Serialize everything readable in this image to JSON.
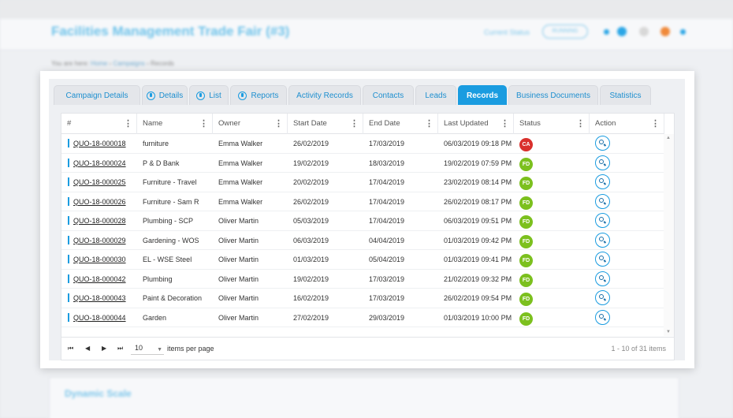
{
  "app": {
    "title": "Facilities Management Trade Fair (#3)",
    "status_label": "Current Status",
    "status_value": "RUNNING"
  },
  "breadcrumb": {
    "prefix": "You are here:",
    "items": [
      "Home",
      "Campaigns",
      "Records"
    ]
  },
  "tabs": [
    {
      "label": "Campaign Details",
      "icon": false,
      "active": false
    },
    {
      "label": "Details",
      "icon": true,
      "active": false
    },
    {
      "label": "List",
      "icon": true,
      "active": false
    },
    {
      "label": "Reports",
      "icon": true,
      "active": false
    },
    {
      "label": "Activity Records",
      "icon": false,
      "active": false
    },
    {
      "label": "Contacts",
      "icon": false,
      "active": false
    },
    {
      "label": "Leads",
      "icon": false,
      "active": false
    },
    {
      "label": "Records",
      "icon": false,
      "active": true
    },
    {
      "label": "Business Documents",
      "icon": false,
      "active": false
    },
    {
      "label": "Statistics",
      "icon": false,
      "active": false
    }
  ],
  "table": {
    "columns": [
      "#",
      "Name",
      "Owner",
      "Start Date",
      "End Date",
      "Last Updated",
      "Status",
      "Action"
    ],
    "rows": [
      {
        "id": "QUO-18-000018",
        "name": "furniture",
        "owner": "Emma Walker",
        "start": "26/02/2019",
        "end": "17/03/2019",
        "updated": "06/03/2019 09:18 PM",
        "status": "CA"
      },
      {
        "id": "QUO-18-000024",
        "name": "P & D Bank",
        "owner": "Emma Walker",
        "start": "19/02/2019",
        "end": "18/03/2019",
        "updated": "19/02/2019 07:59 PM",
        "status": "FD"
      },
      {
        "id": "QUO-18-000025",
        "name": "Furniture - Travel",
        "owner": "Emma Walker",
        "start": "20/02/2019",
        "end": "17/04/2019",
        "updated": "23/02/2019 08:14 PM",
        "status": "FD"
      },
      {
        "id": "QUO-18-000026",
        "name": "Furniture - Sam R",
        "owner": "Emma Walker",
        "start": "26/02/2019",
        "end": "17/04/2019",
        "updated": "26/02/2019 08:17 PM",
        "status": "FD"
      },
      {
        "id": "QUO-18-000028",
        "name": "Plumbing - SCP",
        "owner": "Oliver Martin",
        "start": "05/03/2019",
        "end": "17/04/2019",
        "updated": "06/03/2019 09:51 PM",
        "status": "FD"
      },
      {
        "id": "QUO-18-000029",
        "name": "Gardening - WOS",
        "owner": "Oliver Martin",
        "start": "06/03/2019",
        "end": "04/04/2019",
        "updated": "01/03/2019 09:42 PM",
        "status": "FD"
      },
      {
        "id": "QUO-18-000030",
        "name": "EL - WSE Steel",
        "owner": "Oliver Martin",
        "start": "01/03/2019",
        "end": "05/04/2019",
        "updated": "01/03/2019 09:41 PM",
        "status": "FD"
      },
      {
        "id": "QUO-18-000042",
        "name": "Plumbing",
        "owner": "Oliver Martin",
        "start": "19/02/2019",
        "end": "17/03/2019",
        "updated": "21/02/2019 09:32 PM",
        "status": "FD"
      },
      {
        "id": "QUO-18-000043",
        "name": "Paint & Decoration",
        "owner": "Oliver Martin",
        "start": "16/02/2019",
        "end": "17/03/2019",
        "updated": "26/02/2019 09:54 PM",
        "status": "FD"
      },
      {
        "id": "QUO-18-000044",
        "name": "Garden",
        "owner": "Oliver Martin",
        "start": "27/02/2019",
        "end": "29/03/2019",
        "updated": "01/03/2019 10:00 PM",
        "status": "FD"
      }
    ]
  },
  "status_colors": {
    "CA": "#d9302c",
    "FD": "#7cc01e"
  },
  "pager": {
    "page_size": "10",
    "items_per_page_label": "items per page",
    "info": "1 - 10 of 31 items"
  },
  "bottom": {
    "section_title": "Dynamic Scale"
  }
}
